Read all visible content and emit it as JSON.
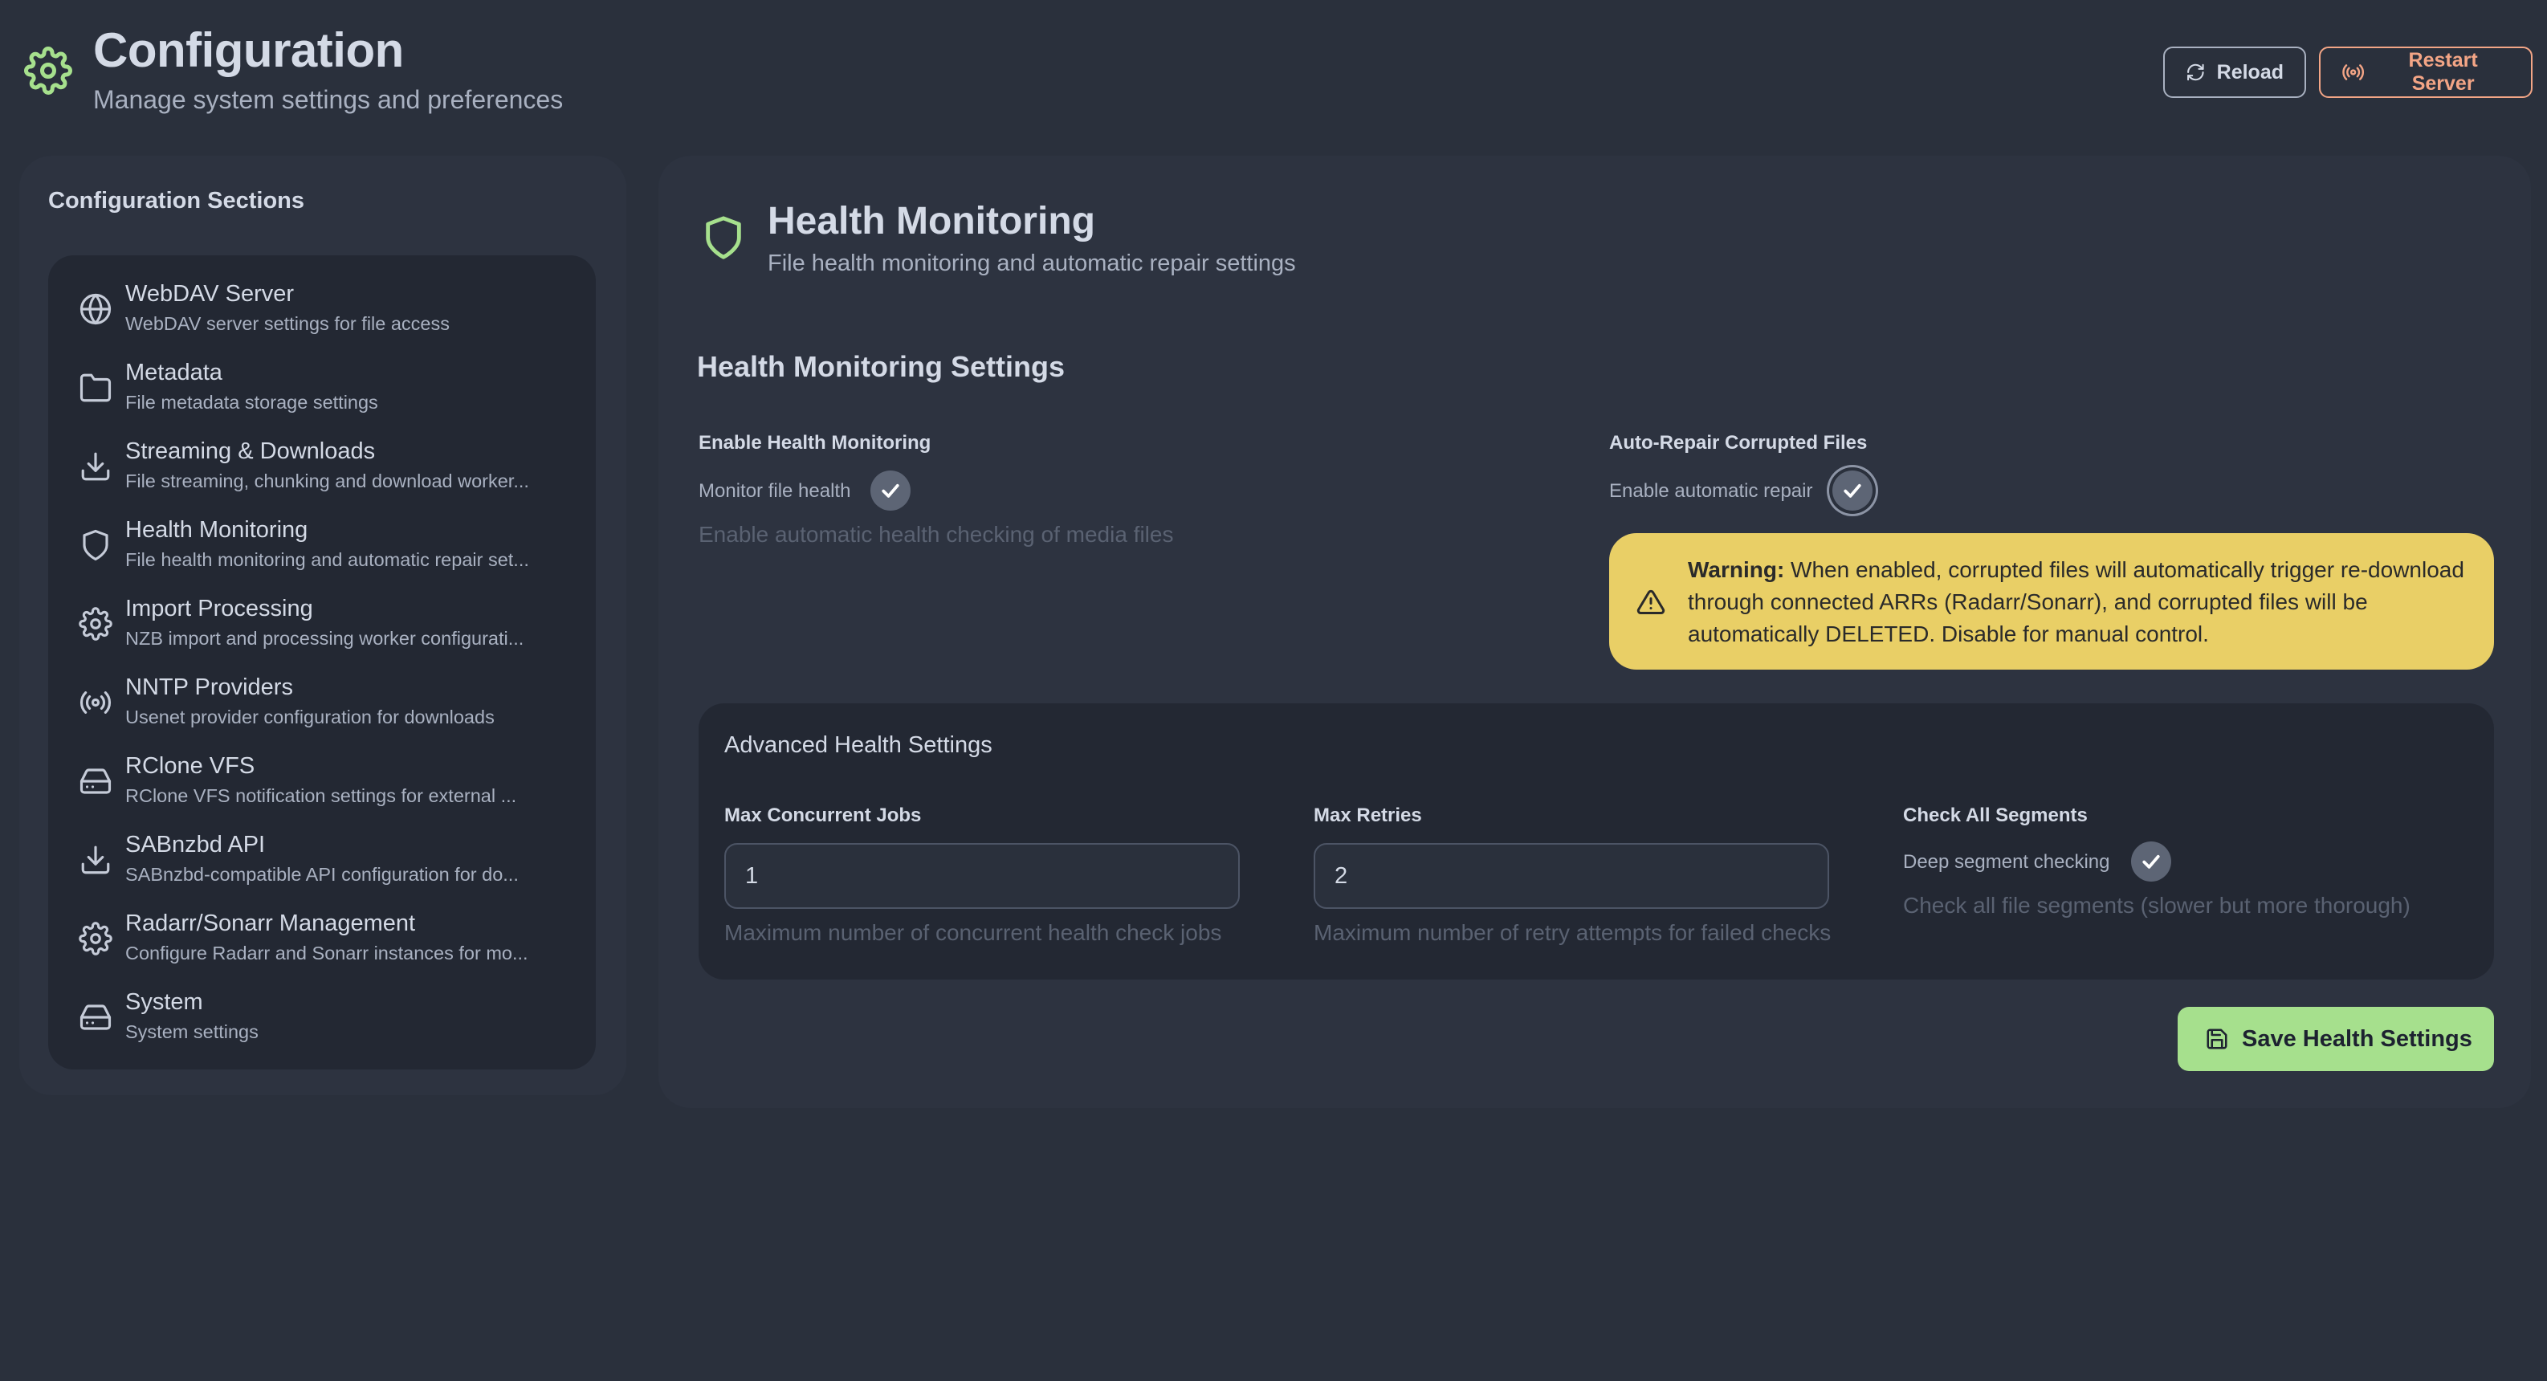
{
  "header": {
    "title": "Configuration",
    "subtitle": "Manage system settings and preferences",
    "reload_label": "Reload",
    "restart_label": "Restart Server",
    "accent_color": "#a6e08d",
    "restart_color": "#f3a586"
  },
  "sidebar": {
    "title": "Configuration Sections",
    "items": [
      {
        "label": "WebDAV Server",
        "desc": "WebDAV server settings for file access",
        "icon": "globe-icon"
      },
      {
        "label": "Metadata",
        "desc": "File metadata storage settings",
        "icon": "folder-icon"
      },
      {
        "label": "Streaming & Downloads",
        "desc": "File streaming, chunking and download worker...",
        "icon": "download-icon"
      },
      {
        "label": "Health Monitoring",
        "desc": "File health monitoring and automatic repair set...",
        "icon": "shield-icon"
      },
      {
        "label": "Import Processing",
        "desc": "NZB import and processing worker configurati...",
        "icon": "gear-icon"
      },
      {
        "label": "NNTP Providers",
        "desc": "Usenet provider configuration for downloads",
        "icon": "broadcast-icon"
      },
      {
        "label": "RClone VFS",
        "desc": "RClone VFS notification settings for external ...",
        "icon": "hard-drive-icon"
      },
      {
        "label": "SABnzbd API",
        "desc": "SABnzbd-compatible API configuration for do...",
        "icon": "download-icon"
      },
      {
        "label": "Radarr/Sonarr Management",
        "desc": "Configure Radarr and Sonarr instances for mo...",
        "icon": "gear-icon"
      },
      {
        "label": "System",
        "desc": "System settings",
        "icon": "hard-drive-icon"
      }
    ],
    "active_index": 3
  },
  "main": {
    "title": "Health Monitoring",
    "subtitle": "File health monitoring and automatic repair settings",
    "settings_heading": "Health Monitoring Settings",
    "enable": {
      "label": "Enable Health Monitoring",
      "toggle_text": "Monitor file health",
      "checked": true,
      "help": "Enable automatic health checking of media files"
    },
    "auto_repair": {
      "label": "Auto-Repair Corrupted Files",
      "toggle_text": "Enable automatic repair",
      "checked": true
    },
    "warning": {
      "bold": "Warning:",
      "text": " When enabled, corrupted files will automatically trigger re-download through connected ARRs (Radarr/Sonarr), and corrupted files will be automatically DELETED. Disable for manual control.",
      "color": "#e9cf66"
    },
    "advanced": {
      "title": "Advanced Health Settings",
      "max_jobs": {
        "label": "Max Concurrent Jobs",
        "value": "1",
        "help": "Maximum number of concurrent health check jobs"
      },
      "max_retries": {
        "label": "Max Retries",
        "value": "2",
        "help": "Maximum number of retry attempts for failed checks"
      },
      "check_all": {
        "label": "Check All Segments",
        "toggle_text": "Deep segment checking",
        "checked": true,
        "help": "Check all file segments (slower but more thorough)"
      }
    },
    "save_label": "Save Health Settings"
  }
}
